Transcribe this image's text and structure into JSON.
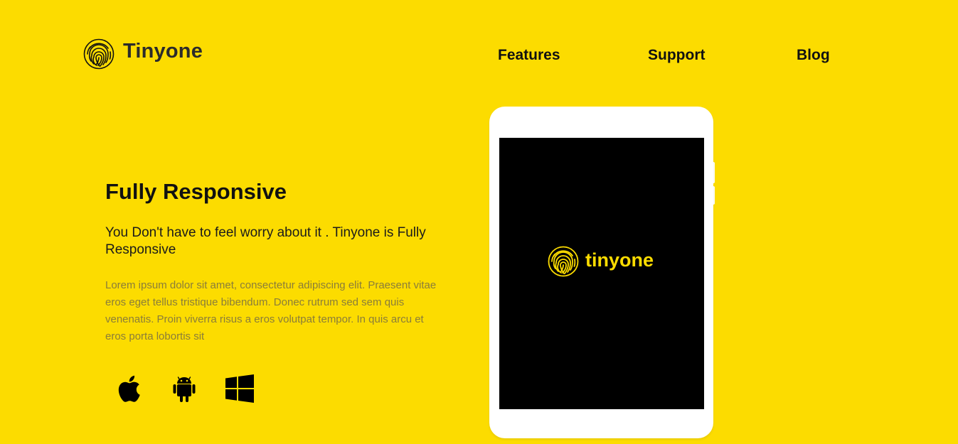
{
  "brand": {
    "name": "Tinyone",
    "icon": "fingerprint-icon",
    "color": "#FCDC00"
  },
  "nav": {
    "items": [
      {
        "label": "Features"
      },
      {
        "label": "Support"
      },
      {
        "label": "Blog"
      }
    ]
  },
  "hero": {
    "title": "Fully Responsive",
    "subtitle": "You Don't have to feel worry about it . Tinyone is Fully Responsive",
    "body": "Lorem ipsum dolor sit amet, consectetur adipiscing elit. Praesent vitae eros eget tellus tristique bibendum. Donec rutrum sed sem quis venenatis. Proin viverra risus a eros volutpat tempor. In quis arcu et eros porta lobortis sit"
  },
  "platforms": [
    {
      "icon": "apple-icon"
    },
    {
      "icon": "android-icon"
    },
    {
      "icon": "windows-icon"
    }
  ],
  "device": {
    "screen_logo_text": "tinyone",
    "screen_background": "#000000"
  }
}
